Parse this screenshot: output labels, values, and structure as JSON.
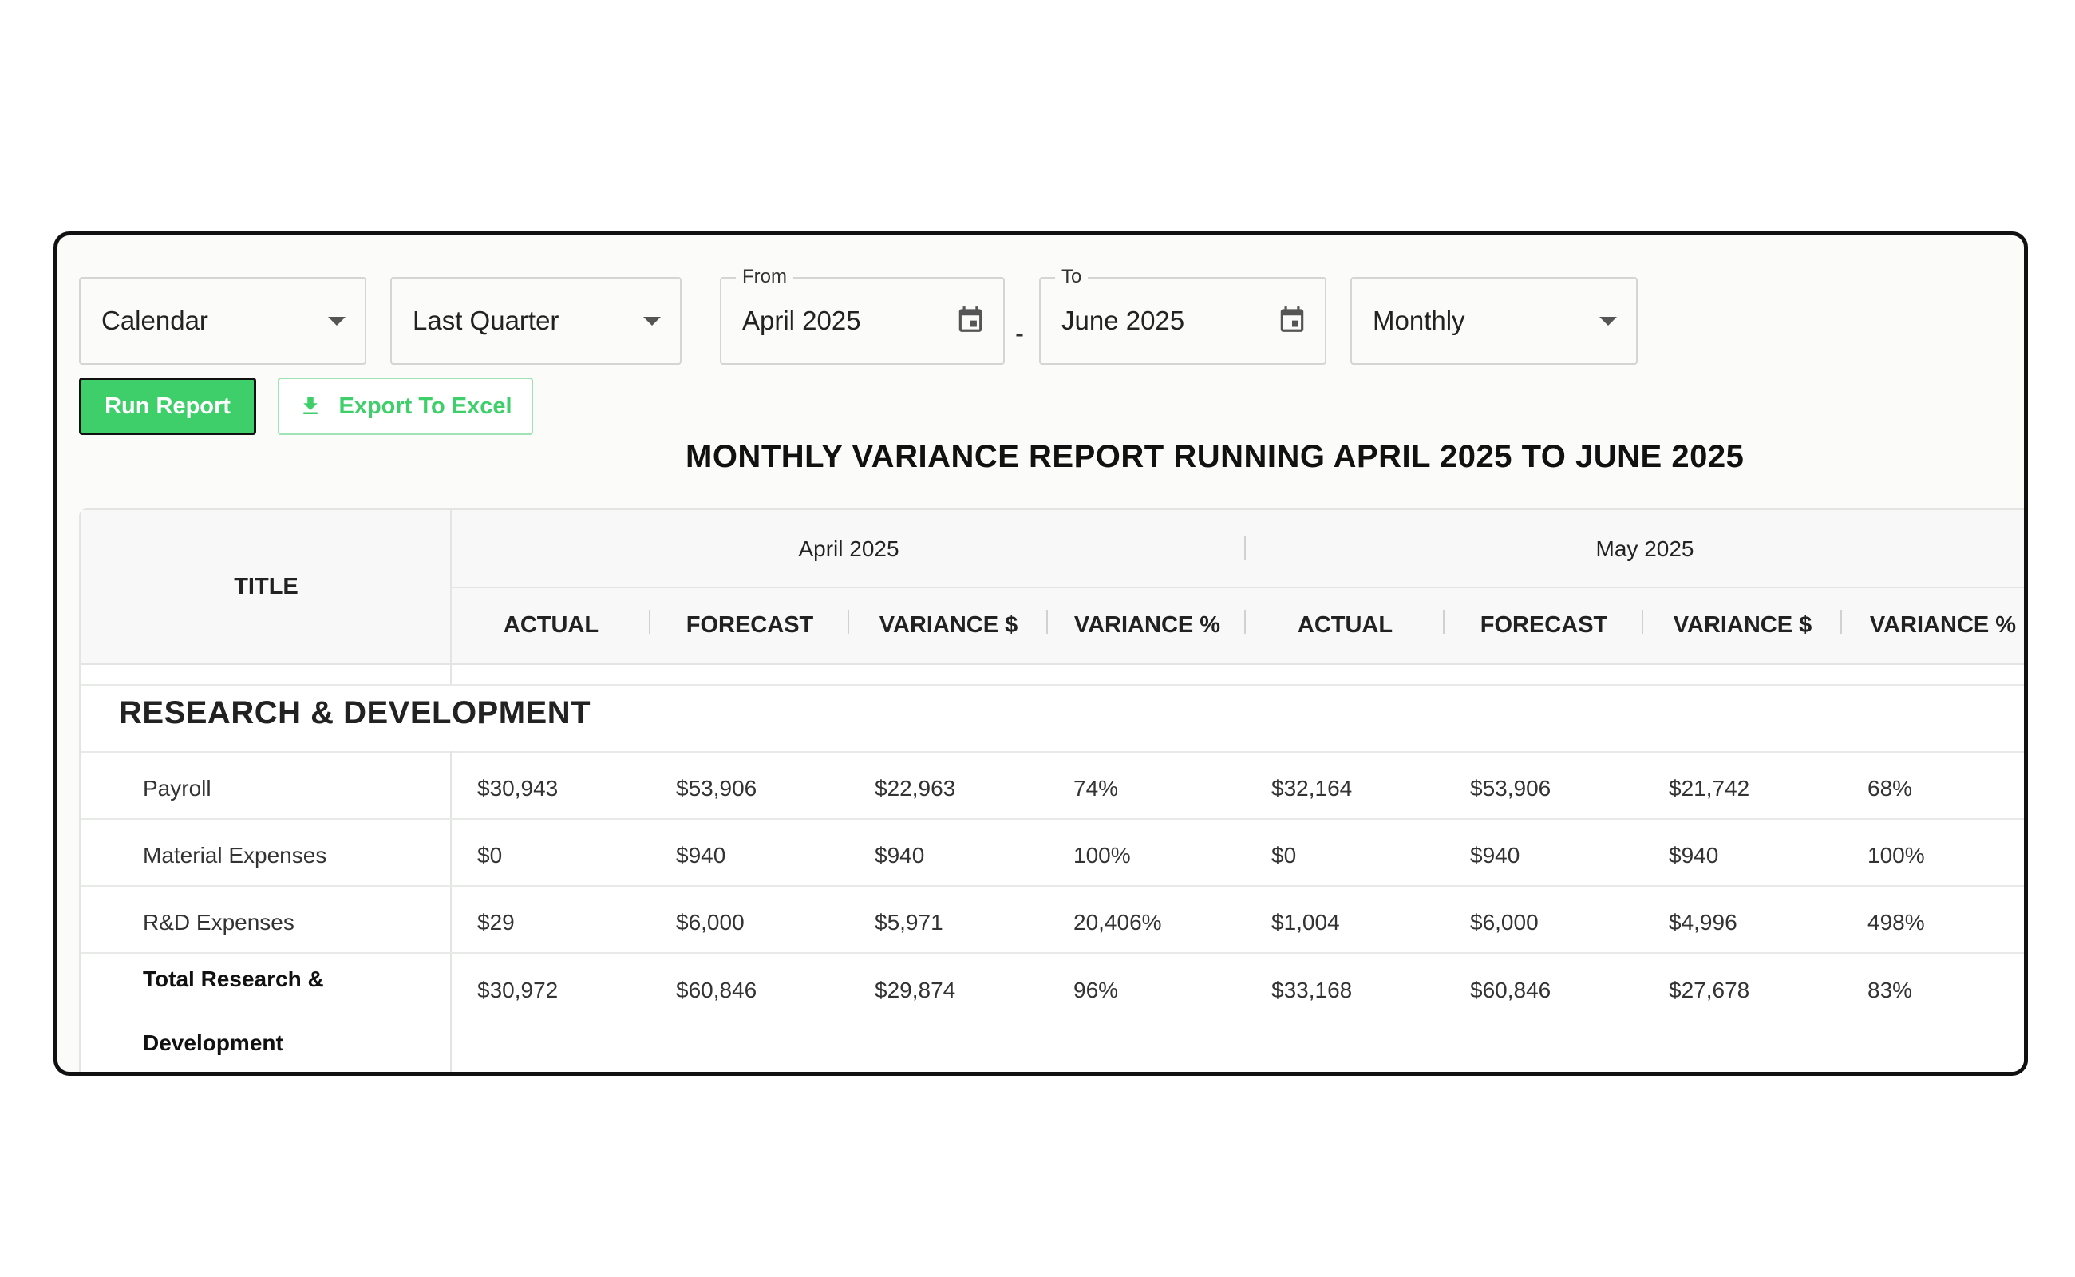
{
  "filters": {
    "calendar": {
      "value": "Calendar"
    },
    "period": {
      "value": "Last Quarter"
    },
    "from": {
      "legend": "From",
      "value": "April 2025"
    },
    "separator": "-",
    "to": {
      "legend": "To",
      "value": "June 2025"
    },
    "granularity": {
      "value": "Monthly"
    }
  },
  "actions": {
    "run_label": "Run Report",
    "export_label": "Export To Excel"
  },
  "report": {
    "title": "MONTHLY VARIANCE REPORT RUNNING APRIL 2025 TO JUNE 2025",
    "title_header": "TITLE",
    "months": [
      "April 2025",
      "May 2025"
    ],
    "columns": [
      "ACTUAL",
      "FORECAST",
      "VARIANCE $",
      "VARIANCE %",
      "ACTUAL",
      "FORECAST",
      "VARIANCE $",
      "VARIANCE %"
    ],
    "section": "RESEARCH & DEVELOPMENT",
    "rows": [
      {
        "label": "Payroll",
        "cells": [
          "$30,943",
          "$53,906",
          "$22,963",
          "74%",
          "$32,164",
          "$53,906",
          "$21,742",
          "68%"
        ]
      },
      {
        "label": "Material Expenses",
        "cells": [
          "$0",
          "$940",
          "$940",
          "100%",
          "$0",
          "$940",
          "$940",
          "100%"
        ]
      },
      {
        "label": "R&D Expenses",
        "cells": [
          "$29",
          "$6,000",
          "$5,971",
          "20,406%",
          "$1,004",
          "$6,000",
          "$4,996",
          "498%"
        ]
      },
      {
        "label": "Total Research & Development",
        "cells": [
          "$30,972",
          "$60,846",
          "$29,874",
          "96%",
          "$33,168",
          "$60,846",
          "$27,678",
          "83%"
        ]
      }
    ]
  },
  "colors": {
    "accent": "#3ecf6a",
    "border": "#111111"
  }
}
